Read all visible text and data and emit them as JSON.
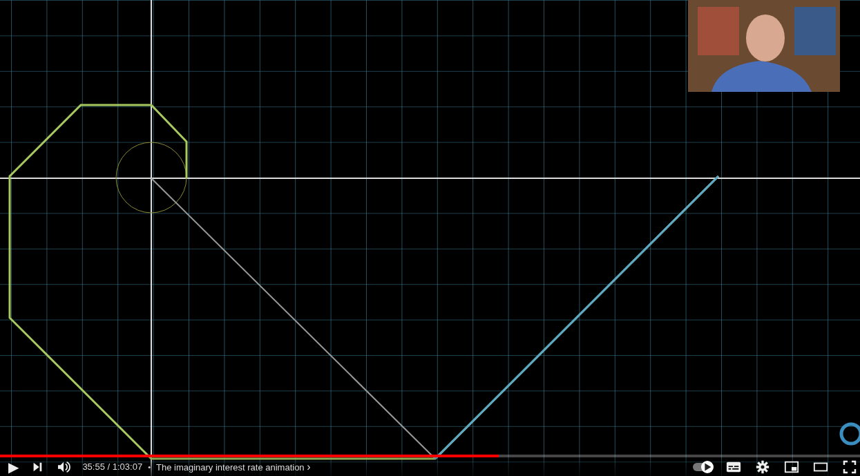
{
  "progress": {
    "level": 0.58
  },
  "controls": {
    "play": "▶",
    "time": "35:55 / 1:03:07",
    "separator": "•",
    "chapter": "The imaginary interest rate animation",
    "chapter_chevron": "›",
    "autoplay": {
      "on": true
    }
  }
}
